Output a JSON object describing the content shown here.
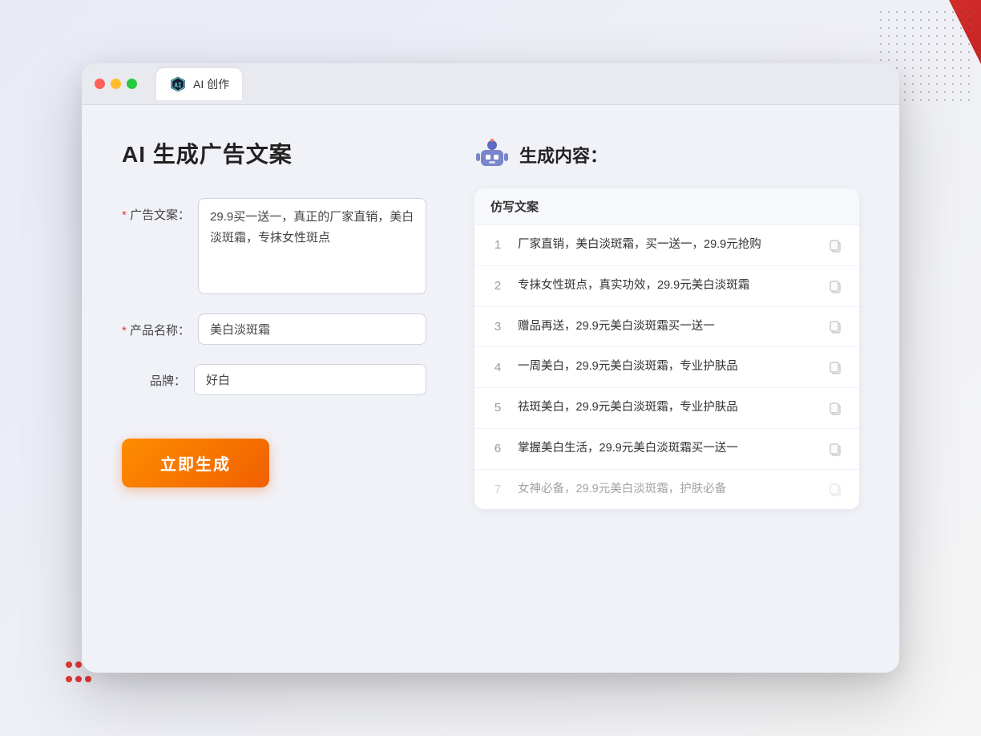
{
  "browser": {
    "tab_label": "AI 创作"
  },
  "page": {
    "title": "AI 生成广告文案",
    "generate_btn": "立即生成"
  },
  "form": {
    "ad_copy_label": "广告文案：",
    "ad_copy_required": true,
    "ad_copy_value": "29.9买一送一，真正的厂家直销，美白淡斑霜，专抹女性斑点",
    "product_name_label": "产品名称：",
    "product_name_required": true,
    "product_name_value": "美白淡斑霜",
    "brand_label": "品牌：",
    "brand_required": false,
    "brand_value": "好白"
  },
  "result": {
    "title": "生成内容：",
    "table_header": "仿写文案",
    "rows": [
      {
        "num": "1",
        "text": "厂家直销，美白淡斑霜，买一送一，29.9元抢购",
        "dimmed": false
      },
      {
        "num": "2",
        "text": "专抹女性斑点，真实功效，29.9元美白淡斑霜",
        "dimmed": false
      },
      {
        "num": "3",
        "text": "赠品再送，29.9元美白淡斑霜买一送一",
        "dimmed": false
      },
      {
        "num": "4",
        "text": "一周美白，29.9元美白淡斑霜，专业护肤品",
        "dimmed": false
      },
      {
        "num": "5",
        "text": "祛斑美白，29.9元美白淡斑霜，专业护肤品",
        "dimmed": false
      },
      {
        "num": "6",
        "text": "掌握美白生活，29.9元美白淡斑霜买一送一",
        "dimmed": false
      },
      {
        "num": "7",
        "text": "女神必备，29.9元美白淡斑霜，护肤必备",
        "dimmed": true
      }
    ]
  }
}
